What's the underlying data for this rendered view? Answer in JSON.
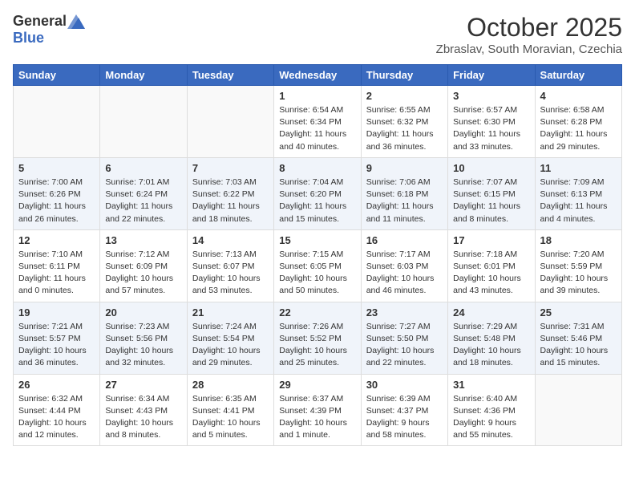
{
  "header": {
    "logo_general": "General",
    "logo_blue": "Blue",
    "month": "October 2025",
    "location": "Zbraslav, South Moravian, Czechia"
  },
  "days_of_week": [
    "Sunday",
    "Monday",
    "Tuesday",
    "Wednesday",
    "Thursday",
    "Friday",
    "Saturday"
  ],
  "weeks": [
    [
      {
        "day": "",
        "info": ""
      },
      {
        "day": "",
        "info": ""
      },
      {
        "day": "",
        "info": ""
      },
      {
        "day": "1",
        "info": "Sunrise: 6:54 AM\nSunset: 6:34 PM\nDaylight: 11 hours\nand 40 minutes."
      },
      {
        "day": "2",
        "info": "Sunrise: 6:55 AM\nSunset: 6:32 PM\nDaylight: 11 hours\nand 36 minutes."
      },
      {
        "day": "3",
        "info": "Sunrise: 6:57 AM\nSunset: 6:30 PM\nDaylight: 11 hours\nand 33 minutes."
      },
      {
        "day": "4",
        "info": "Sunrise: 6:58 AM\nSunset: 6:28 PM\nDaylight: 11 hours\nand 29 minutes."
      }
    ],
    [
      {
        "day": "5",
        "info": "Sunrise: 7:00 AM\nSunset: 6:26 PM\nDaylight: 11 hours\nand 26 minutes."
      },
      {
        "day": "6",
        "info": "Sunrise: 7:01 AM\nSunset: 6:24 PM\nDaylight: 11 hours\nand 22 minutes."
      },
      {
        "day": "7",
        "info": "Sunrise: 7:03 AM\nSunset: 6:22 PM\nDaylight: 11 hours\nand 18 minutes."
      },
      {
        "day": "8",
        "info": "Sunrise: 7:04 AM\nSunset: 6:20 PM\nDaylight: 11 hours\nand 15 minutes."
      },
      {
        "day": "9",
        "info": "Sunrise: 7:06 AM\nSunset: 6:18 PM\nDaylight: 11 hours\nand 11 minutes."
      },
      {
        "day": "10",
        "info": "Sunrise: 7:07 AM\nSunset: 6:15 PM\nDaylight: 11 hours\nand 8 minutes."
      },
      {
        "day": "11",
        "info": "Sunrise: 7:09 AM\nSunset: 6:13 PM\nDaylight: 11 hours\nand 4 minutes."
      }
    ],
    [
      {
        "day": "12",
        "info": "Sunrise: 7:10 AM\nSunset: 6:11 PM\nDaylight: 11 hours\nand 0 minutes."
      },
      {
        "day": "13",
        "info": "Sunrise: 7:12 AM\nSunset: 6:09 PM\nDaylight: 10 hours\nand 57 minutes."
      },
      {
        "day": "14",
        "info": "Sunrise: 7:13 AM\nSunset: 6:07 PM\nDaylight: 10 hours\nand 53 minutes."
      },
      {
        "day": "15",
        "info": "Sunrise: 7:15 AM\nSunset: 6:05 PM\nDaylight: 10 hours\nand 50 minutes."
      },
      {
        "day": "16",
        "info": "Sunrise: 7:17 AM\nSunset: 6:03 PM\nDaylight: 10 hours\nand 46 minutes."
      },
      {
        "day": "17",
        "info": "Sunrise: 7:18 AM\nSunset: 6:01 PM\nDaylight: 10 hours\nand 43 minutes."
      },
      {
        "day": "18",
        "info": "Sunrise: 7:20 AM\nSunset: 5:59 PM\nDaylight: 10 hours\nand 39 minutes."
      }
    ],
    [
      {
        "day": "19",
        "info": "Sunrise: 7:21 AM\nSunset: 5:57 PM\nDaylight: 10 hours\nand 36 minutes."
      },
      {
        "day": "20",
        "info": "Sunrise: 7:23 AM\nSunset: 5:56 PM\nDaylight: 10 hours\nand 32 minutes."
      },
      {
        "day": "21",
        "info": "Sunrise: 7:24 AM\nSunset: 5:54 PM\nDaylight: 10 hours\nand 29 minutes."
      },
      {
        "day": "22",
        "info": "Sunrise: 7:26 AM\nSunset: 5:52 PM\nDaylight: 10 hours\nand 25 minutes."
      },
      {
        "day": "23",
        "info": "Sunrise: 7:27 AM\nSunset: 5:50 PM\nDaylight: 10 hours\nand 22 minutes."
      },
      {
        "day": "24",
        "info": "Sunrise: 7:29 AM\nSunset: 5:48 PM\nDaylight: 10 hours\nand 18 minutes."
      },
      {
        "day": "25",
        "info": "Sunrise: 7:31 AM\nSunset: 5:46 PM\nDaylight: 10 hours\nand 15 minutes."
      }
    ],
    [
      {
        "day": "26",
        "info": "Sunrise: 6:32 AM\nSunset: 4:44 PM\nDaylight: 10 hours\nand 12 minutes."
      },
      {
        "day": "27",
        "info": "Sunrise: 6:34 AM\nSunset: 4:43 PM\nDaylight: 10 hours\nand 8 minutes."
      },
      {
        "day": "28",
        "info": "Sunrise: 6:35 AM\nSunset: 4:41 PM\nDaylight: 10 hours\nand 5 minutes."
      },
      {
        "day": "29",
        "info": "Sunrise: 6:37 AM\nSunset: 4:39 PM\nDaylight: 10 hours\nand 1 minute."
      },
      {
        "day": "30",
        "info": "Sunrise: 6:39 AM\nSunset: 4:37 PM\nDaylight: 9 hours\nand 58 minutes."
      },
      {
        "day": "31",
        "info": "Sunrise: 6:40 AM\nSunset: 4:36 PM\nDaylight: 9 hours\nand 55 minutes."
      },
      {
        "day": "",
        "info": ""
      }
    ]
  ]
}
